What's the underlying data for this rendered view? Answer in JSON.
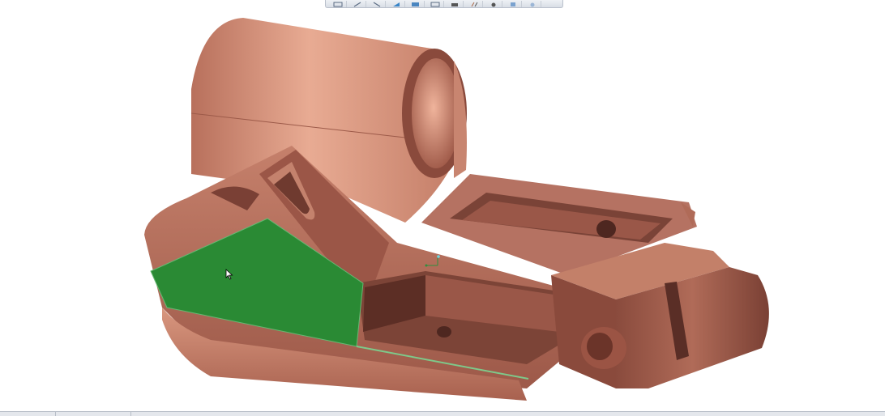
{
  "window": {
    "title": ""
  },
  "toolbar": {
    "buttons": [
      {
        "icon": "zoom-fit-icon"
      },
      {
        "icon": "zoom-in-icon"
      },
      {
        "icon": "zoom-out-icon"
      },
      {
        "icon": "repaint-icon"
      },
      {
        "icon": "shading-mode-icon"
      },
      {
        "icon": "saved-views-icon"
      },
      {
        "icon": "display-style-icon"
      },
      {
        "icon": "datum-display-icon"
      },
      {
        "icon": "annotation-display-icon"
      },
      {
        "icon": "view-manager-icon"
      },
      {
        "icon": "appearance-icon"
      }
    ]
  },
  "colors": {
    "part_base": "#c7826d",
    "part_light": "#e3a48c",
    "part_shadow": "#7a4337",
    "part_dark": "#5a2e26",
    "selected_face": "#2a8a34",
    "selection_edge": "#7ec98a"
  },
  "statusbar": {
    "tabs": [
      "",
      ""
    ]
  }
}
